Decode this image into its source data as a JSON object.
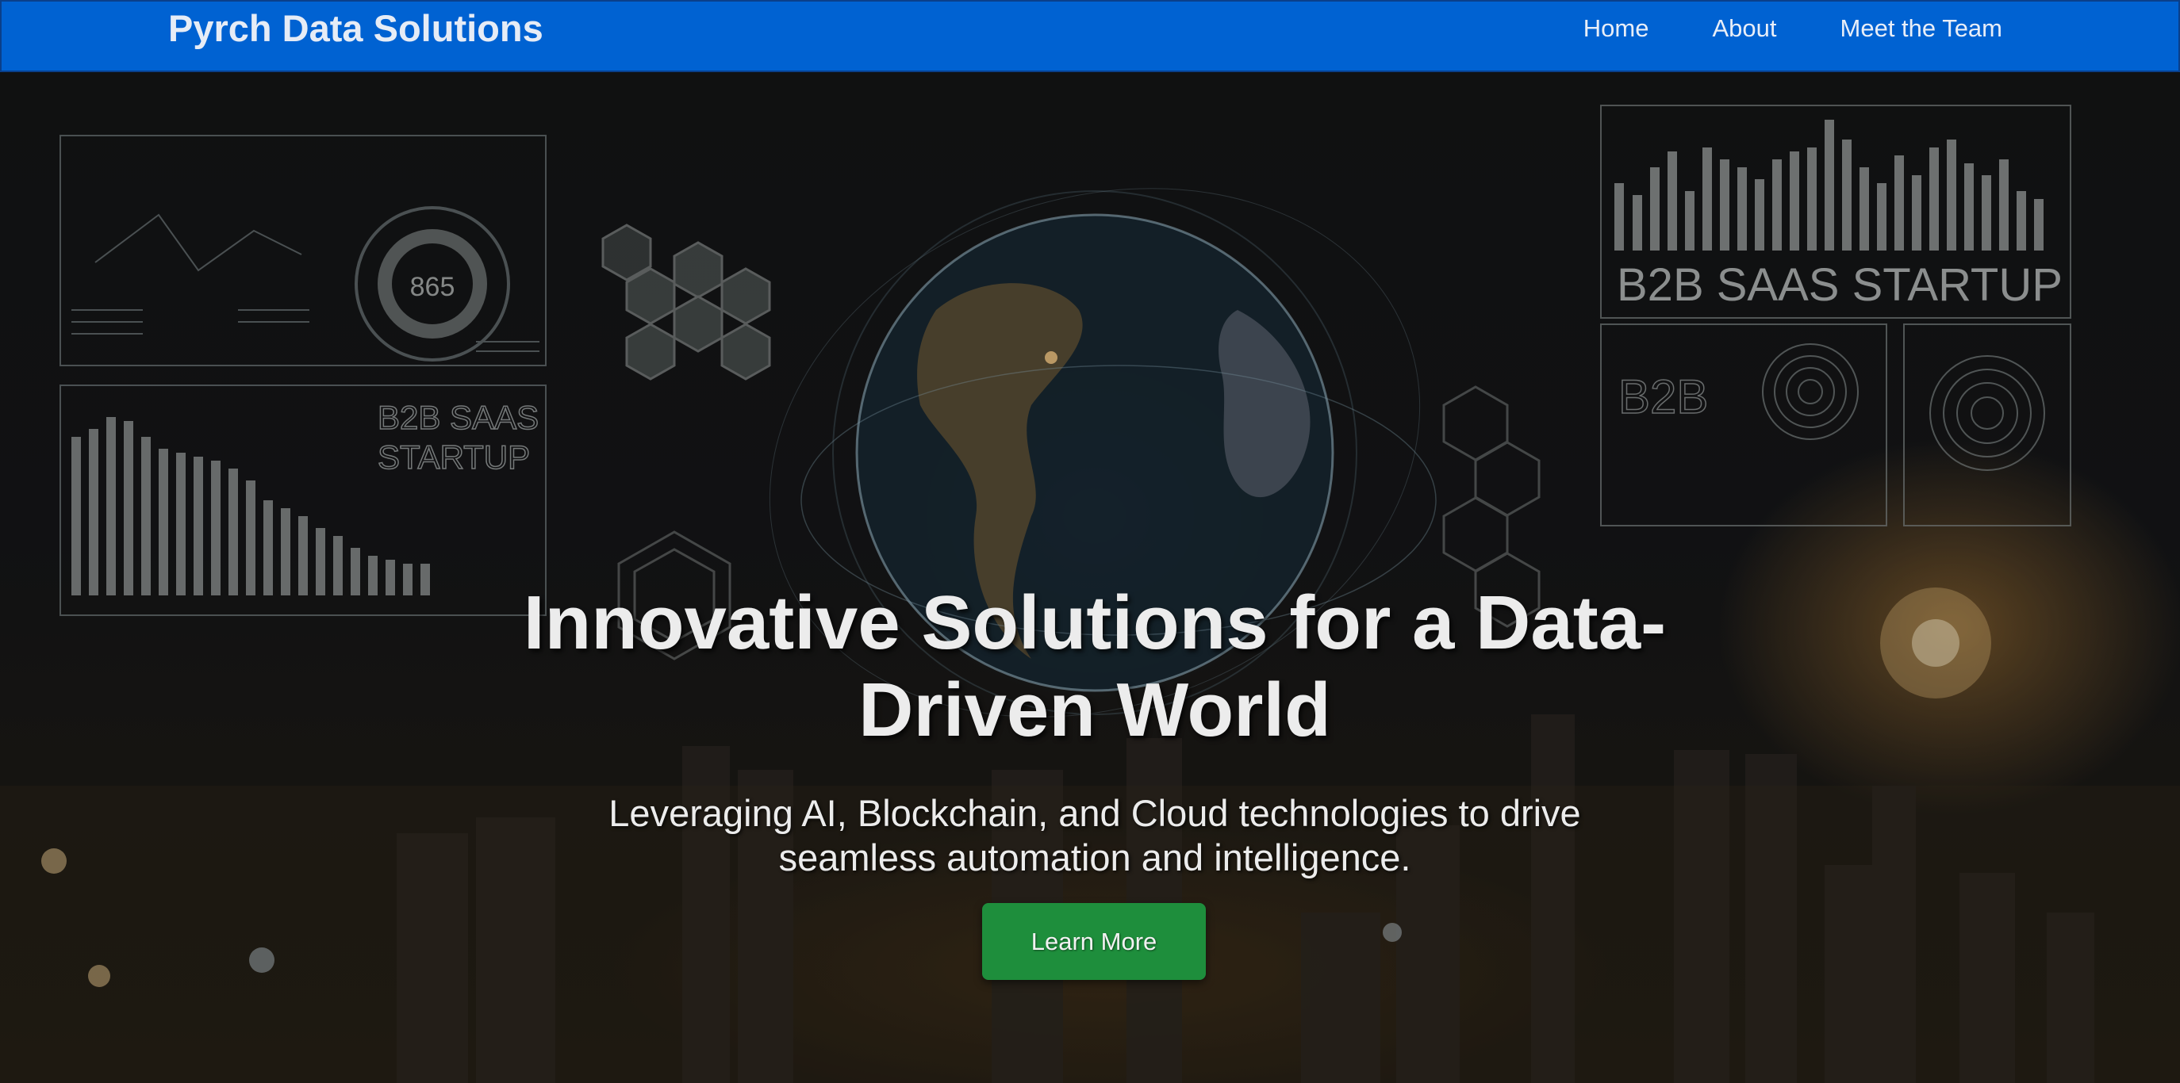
{
  "navbar": {
    "brand": "Pyrch Data Solutions",
    "links": [
      "Home",
      "About",
      "Meet the Team"
    ],
    "background": "#0062d2"
  },
  "hero": {
    "title": "Innovative Solutions for a Data-Driven World",
    "subtitle": "Leveraging AI, Blockchain, and Cloud technologies to drive seamless automation and intelligence.",
    "cta_label": "Learn More",
    "cta_color": "#1e8e3c",
    "background_image": {
      "texts": [
        "B2B SAAS STARTUP",
        "B2B SAAS STARTUP",
        "B2B",
        "865"
      ]
    }
  }
}
